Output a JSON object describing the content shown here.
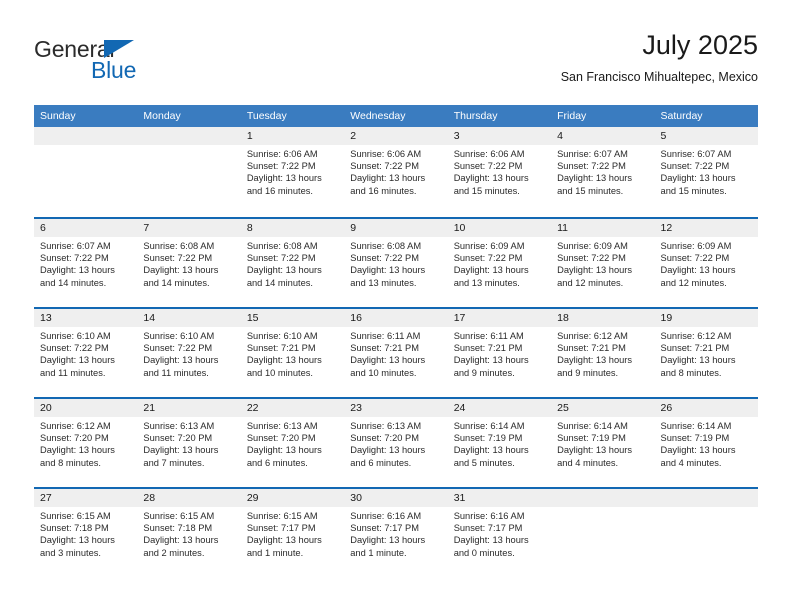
{
  "logo": {
    "text_primary": "General",
    "text_secondary": "Blue",
    "triangle_icon": "triangle-icon",
    "color_primary": "#2b2b2b",
    "color_secondary": "#1268b3"
  },
  "header": {
    "title": "July 2025",
    "subtitle": "San Francisco Mihualtepec, Mexico"
  },
  "theme": {
    "header_bg": "#3a7cc0",
    "row_divider": "#1268b3",
    "day_band_bg": "#efefef",
    "text": "#1a1a1a"
  },
  "calendar": {
    "day_headers": [
      "Sunday",
      "Monday",
      "Tuesday",
      "Wednesday",
      "Thursday",
      "Friday",
      "Saturday"
    ],
    "weeks": [
      [
        {
          "day": "",
          "sunrise": "",
          "sunset": "",
          "daylight_line1": "",
          "daylight_line2": ""
        },
        {
          "day": "",
          "sunrise": "",
          "sunset": "",
          "daylight_line1": "",
          "daylight_line2": ""
        },
        {
          "day": "1",
          "sunrise": "Sunrise: 6:06 AM",
          "sunset": "Sunset: 7:22 PM",
          "daylight_line1": "Daylight: 13 hours",
          "daylight_line2": "and 16 minutes."
        },
        {
          "day": "2",
          "sunrise": "Sunrise: 6:06 AM",
          "sunset": "Sunset: 7:22 PM",
          "daylight_line1": "Daylight: 13 hours",
          "daylight_line2": "and 16 minutes."
        },
        {
          "day": "3",
          "sunrise": "Sunrise: 6:06 AM",
          "sunset": "Sunset: 7:22 PM",
          "daylight_line1": "Daylight: 13 hours",
          "daylight_line2": "and 15 minutes."
        },
        {
          "day": "4",
          "sunrise": "Sunrise: 6:07 AM",
          "sunset": "Sunset: 7:22 PM",
          "daylight_line1": "Daylight: 13 hours",
          "daylight_line2": "and 15 minutes."
        },
        {
          "day": "5",
          "sunrise": "Sunrise: 6:07 AM",
          "sunset": "Sunset: 7:22 PM",
          "daylight_line1": "Daylight: 13 hours",
          "daylight_line2": "and 15 minutes."
        }
      ],
      [
        {
          "day": "6",
          "sunrise": "Sunrise: 6:07 AM",
          "sunset": "Sunset: 7:22 PM",
          "daylight_line1": "Daylight: 13 hours",
          "daylight_line2": "and 14 minutes."
        },
        {
          "day": "7",
          "sunrise": "Sunrise: 6:08 AM",
          "sunset": "Sunset: 7:22 PM",
          "daylight_line1": "Daylight: 13 hours",
          "daylight_line2": "and 14 minutes."
        },
        {
          "day": "8",
          "sunrise": "Sunrise: 6:08 AM",
          "sunset": "Sunset: 7:22 PM",
          "daylight_line1": "Daylight: 13 hours",
          "daylight_line2": "and 14 minutes."
        },
        {
          "day": "9",
          "sunrise": "Sunrise: 6:08 AM",
          "sunset": "Sunset: 7:22 PM",
          "daylight_line1": "Daylight: 13 hours",
          "daylight_line2": "and 13 minutes."
        },
        {
          "day": "10",
          "sunrise": "Sunrise: 6:09 AM",
          "sunset": "Sunset: 7:22 PM",
          "daylight_line1": "Daylight: 13 hours",
          "daylight_line2": "and 13 minutes."
        },
        {
          "day": "11",
          "sunrise": "Sunrise: 6:09 AM",
          "sunset": "Sunset: 7:22 PM",
          "daylight_line1": "Daylight: 13 hours",
          "daylight_line2": "and 12 minutes."
        },
        {
          "day": "12",
          "sunrise": "Sunrise: 6:09 AM",
          "sunset": "Sunset: 7:22 PM",
          "daylight_line1": "Daylight: 13 hours",
          "daylight_line2": "and 12 minutes."
        }
      ],
      [
        {
          "day": "13",
          "sunrise": "Sunrise: 6:10 AM",
          "sunset": "Sunset: 7:22 PM",
          "daylight_line1": "Daylight: 13 hours",
          "daylight_line2": "and 11 minutes."
        },
        {
          "day": "14",
          "sunrise": "Sunrise: 6:10 AM",
          "sunset": "Sunset: 7:22 PM",
          "daylight_line1": "Daylight: 13 hours",
          "daylight_line2": "and 11 minutes."
        },
        {
          "day": "15",
          "sunrise": "Sunrise: 6:10 AM",
          "sunset": "Sunset: 7:21 PM",
          "daylight_line1": "Daylight: 13 hours",
          "daylight_line2": "and 10 minutes."
        },
        {
          "day": "16",
          "sunrise": "Sunrise: 6:11 AM",
          "sunset": "Sunset: 7:21 PM",
          "daylight_line1": "Daylight: 13 hours",
          "daylight_line2": "and 10 minutes."
        },
        {
          "day": "17",
          "sunrise": "Sunrise: 6:11 AM",
          "sunset": "Sunset: 7:21 PM",
          "daylight_line1": "Daylight: 13 hours",
          "daylight_line2": "and 9 minutes."
        },
        {
          "day": "18",
          "sunrise": "Sunrise: 6:12 AM",
          "sunset": "Sunset: 7:21 PM",
          "daylight_line1": "Daylight: 13 hours",
          "daylight_line2": "and 9 minutes."
        },
        {
          "day": "19",
          "sunrise": "Sunrise: 6:12 AM",
          "sunset": "Sunset: 7:21 PM",
          "daylight_line1": "Daylight: 13 hours",
          "daylight_line2": "and 8 minutes."
        }
      ],
      [
        {
          "day": "20",
          "sunrise": "Sunrise: 6:12 AM",
          "sunset": "Sunset: 7:20 PM",
          "daylight_line1": "Daylight: 13 hours",
          "daylight_line2": "and 8 minutes."
        },
        {
          "day": "21",
          "sunrise": "Sunrise: 6:13 AM",
          "sunset": "Sunset: 7:20 PM",
          "daylight_line1": "Daylight: 13 hours",
          "daylight_line2": "and 7 minutes."
        },
        {
          "day": "22",
          "sunrise": "Sunrise: 6:13 AM",
          "sunset": "Sunset: 7:20 PM",
          "daylight_line1": "Daylight: 13 hours",
          "daylight_line2": "and 6 minutes."
        },
        {
          "day": "23",
          "sunrise": "Sunrise: 6:13 AM",
          "sunset": "Sunset: 7:20 PM",
          "daylight_line1": "Daylight: 13 hours",
          "daylight_line2": "and 6 minutes."
        },
        {
          "day": "24",
          "sunrise": "Sunrise: 6:14 AM",
          "sunset": "Sunset: 7:19 PM",
          "daylight_line1": "Daylight: 13 hours",
          "daylight_line2": "and 5 minutes."
        },
        {
          "day": "25",
          "sunrise": "Sunrise: 6:14 AM",
          "sunset": "Sunset: 7:19 PM",
          "daylight_line1": "Daylight: 13 hours",
          "daylight_line2": "and 4 minutes."
        },
        {
          "day": "26",
          "sunrise": "Sunrise: 6:14 AM",
          "sunset": "Sunset: 7:19 PM",
          "daylight_line1": "Daylight: 13 hours",
          "daylight_line2": "and 4 minutes."
        }
      ],
      [
        {
          "day": "27",
          "sunrise": "Sunrise: 6:15 AM",
          "sunset": "Sunset: 7:18 PM",
          "daylight_line1": "Daylight: 13 hours",
          "daylight_line2": "and 3 minutes."
        },
        {
          "day": "28",
          "sunrise": "Sunrise: 6:15 AM",
          "sunset": "Sunset: 7:18 PM",
          "daylight_line1": "Daylight: 13 hours",
          "daylight_line2": "and 2 minutes."
        },
        {
          "day": "29",
          "sunrise": "Sunrise: 6:15 AM",
          "sunset": "Sunset: 7:17 PM",
          "daylight_line1": "Daylight: 13 hours",
          "daylight_line2": "and 1 minute."
        },
        {
          "day": "30",
          "sunrise": "Sunrise: 6:16 AM",
          "sunset": "Sunset: 7:17 PM",
          "daylight_line1": "Daylight: 13 hours",
          "daylight_line2": "and 1 minute."
        },
        {
          "day": "31",
          "sunrise": "Sunrise: 6:16 AM",
          "sunset": "Sunset: 7:17 PM",
          "daylight_line1": "Daylight: 13 hours",
          "daylight_line2": "and 0 minutes."
        },
        {
          "day": "",
          "sunrise": "",
          "sunset": "",
          "daylight_line1": "",
          "daylight_line2": ""
        },
        {
          "day": "",
          "sunrise": "",
          "sunset": "",
          "daylight_line1": "",
          "daylight_line2": ""
        }
      ]
    ]
  }
}
